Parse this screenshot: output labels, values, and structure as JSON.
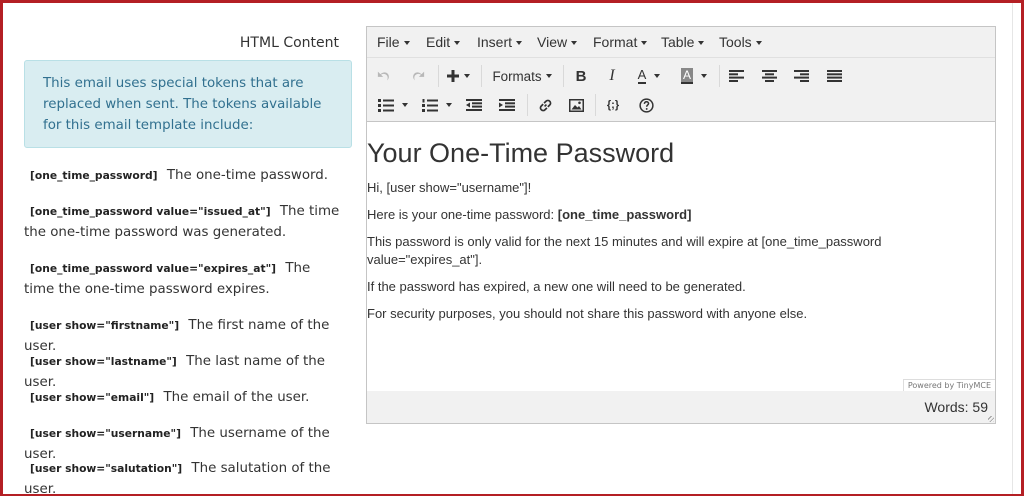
{
  "section_label": "HTML Content",
  "info_text": "This email uses special tokens that are replaced when sent. The tokens available for this email template include:",
  "tokens": [
    {
      "code": "[one_time_password]",
      "desc": "The one-time password."
    },
    {
      "code": "[one_time_password value=\"issued_at\"]",
      "desc": "The time the one-time password was generated."
    },
    {
      "code": "[one_time_password value=\"expires_at\"]",
      "desc": "The time the one-time password expires."
    },
    {
      "code": "[user show=\"firstname\"]",
      "desc": "The first name of the user."
    },
    {
      "code": "[user show=\"lastname\"]",
      "desc": "The last name of the user."
    },
    {
      "code": "[user show=\"email\"]",
      "desc": "The email of the user."
    },
    {
      "code": "[user show=\"username\"]",
      "desc": "The username of the user."
    },
    {
      "code": "[user show=\"salutation\"]",
      "desc": "The salutation of the user."
    }
  ],
  "editor": {
    "menus": [
      "File",
      "Edit",
      "Insert",
      "View",
      "Format",
      "Table",
      "Tools"
    ],
    "formats_label": "Formats",
    "toolbar_icons": {
      "undo": "undo-icon",
      "redo": "redo-icon",
      "insert": "plus-icon",
      "bold": "B",
      "italic": "I",
      "text_color": "A",
      "bg_color": "A",
      "align_left": "align-left-icon",
      "align_center": "align-center-icon",
      "align_right": "align-right-icon",
      "align_justify": "align-justify-icon",
      "bullet_list": "bullet-list-icon",
      "numbered_list": "numbered-list-icon",
      "outdent": "outdent-icon",
      "indent": "indent-icon",
      "link": "link-icon",
      "image": "image-icon",
      "code": "{;}",
      "help": "help-icon"
    },
    "content": {
      "title": "Your One-Time Password",
      "greeting": "Hi, [user show=\"username\"]!",
      "otp_prefix": "Here is your one-time password: ",
      "otp_token": "[one_time_password]",
      "validity": "This password is only valid for the next 15 minutes and will expire at [one_time_password value=\"expires_at\"].",
      "expired": "If the password has expired, a new one will need to be generated.",
      "security": "For security purposes, you should not share this password with anyone else."
    },
    "powered_by": "Powered by TinyMCE",
    "word_count": "Words: 59"
  },
  "colors": {
    "frame_border": "#b41f24",
    "info_bg": "#d9edf1",
    "info_text": "#31708f"
  }
}
